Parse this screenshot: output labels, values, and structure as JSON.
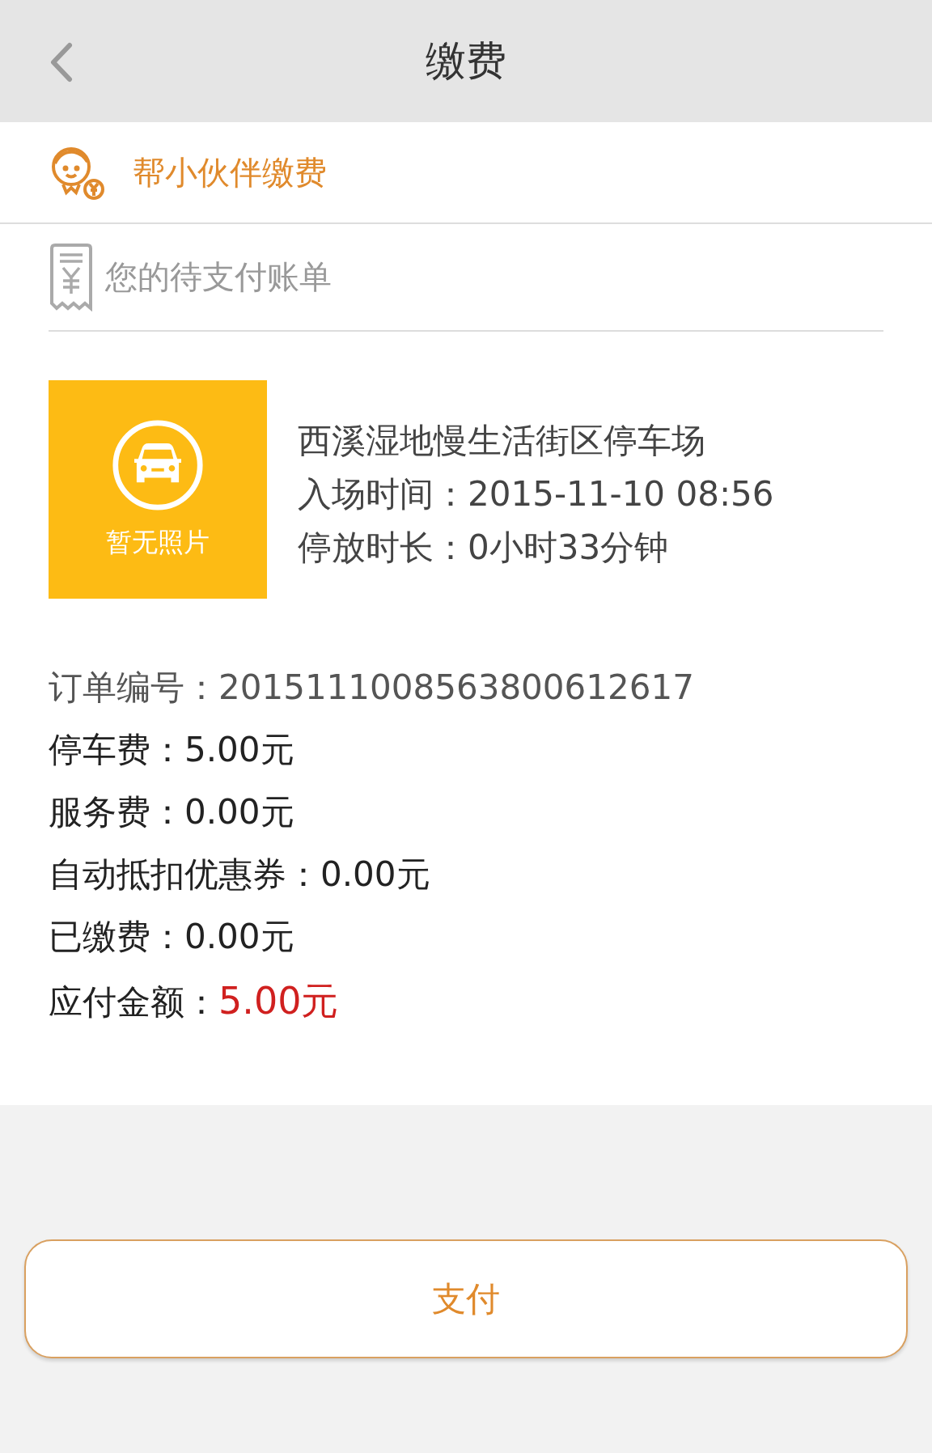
{
  "header": {
    "title": "缴费"
  },
  "helper": {
    "label": "帮小伙伴缴费"
  },
  "bill": {
    "heading": "您的待支付账单",
    "photo": {
      "caption": "暂无照片"
    },
    "lot": "西溪湿地慢生活街区停车场",
    "info": [
      {
        "label": "入场时间：",
        "value": "2015-11-10 08:56"
      },
      {
        "label": "停放时长：",
        "value": "0小时33分钟"
      }
    ],
    "details": [
      {
        "kind": "plain",
        "label": "订单编号：",
        "value": "2015111008563800612617"
      },
      {
        "kind": "plain",
        "label": "停车费：",
        "value": "5.00元"
      },
      {
        "kind": "plain",
        "label": "服务费：",
        "value": "0.00元"
      },
      {
        "kind": "plain",
        "label": "自动抵扣优惠券：",
        "value": "0.00元"
      },
      {
        "kind": "plain",
        "label": "已缴费：",
        "value": "0.00元"
      },
      {
        "kind": "amount",
        "label": "应付金额：",
        "value": "5.00元"
      }
    ]
  },
  "pay_button": "支付"
}
